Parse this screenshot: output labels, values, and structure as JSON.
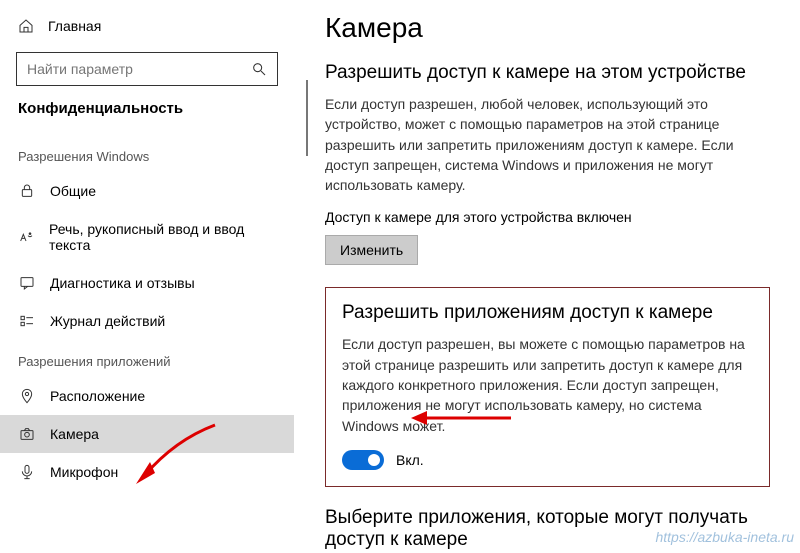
{
  "sidebar": {
    "home": "Главная",
    "search_placeholder": "Найти параметр",
    "title": "Конфиденциальность",
    "group_windows": "Разрешения Windows",
    "items_windows": [
      {
        "label": "Общие"
      },
      {
        "label": "Речь, рукописный ввод и ввод текста"
      },
      {
        "label": "Диагностика и отзывы"
      },
      {
        "label": "Журнал действий"
      }
    ],
    "group_apps": "Разрешения приложений",
    "items_apps": [
      {
        "label": "Расположение"
      },
      {
        "label": "Камера"
      },
      {
        "label": "Микрофон"
      }
    ]
  },
  "content": {
    "page_title": "Камера",
    "section1": {
      "head": "Разрешить доступ к камере на этом устройстве",
      "desc": "Если доступ разрешен, любой человек, использующий это устройство, может с помощью параметров на этой странице разрешить или запретить приложениям доступ к камере. Если доступ запрещен, система Windows и приложения не могут использовать камеру.",
      "status": "Доступ к камере для этого устройства включен",
      "change_btn": "Изменить"
    },
    "section2": {
      "head": "Разрешить приложениям доступ к камере",
      "desc": "Если доступ разрешен, вы можете с помощью параметров на этой странице разрешить или запретить доступ к камере для каждого конкретного приложения. Если доступ запрещен, приложения не могут использовать камеру, но система Windows может.",
      "toggle_label": "Вкл."
    },
    "footer_head": "Выберите приложения, которые могут получать доступ к камере"
  },
  "watermark": "https://azbuka-ineta.ru"
}
